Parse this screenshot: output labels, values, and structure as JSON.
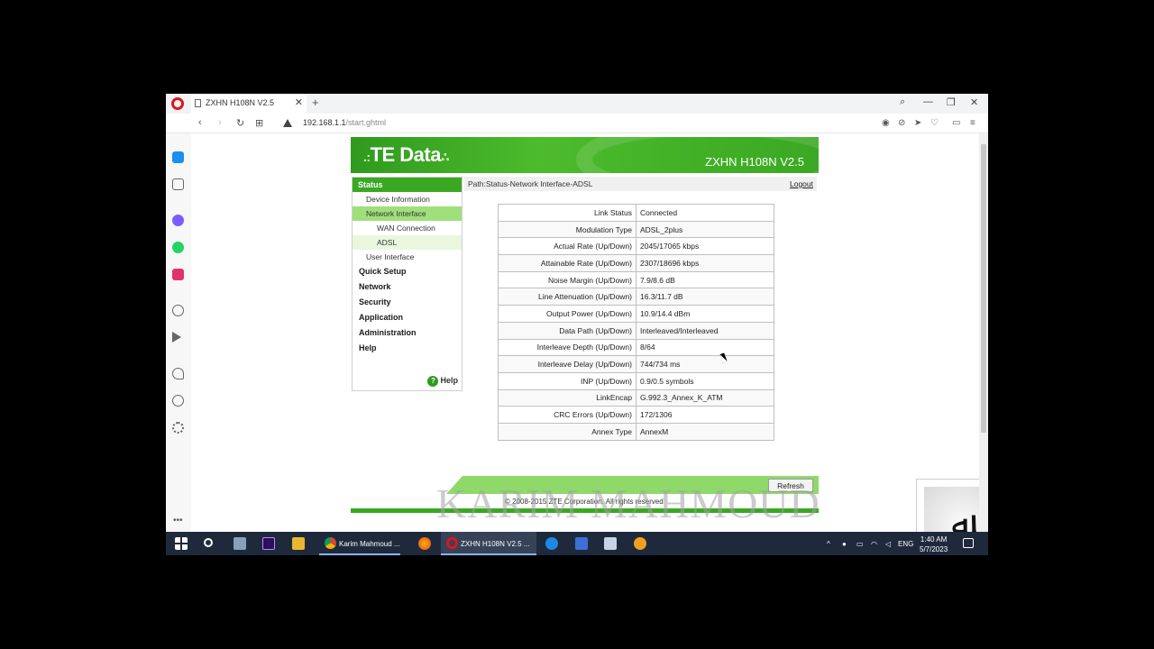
{
  "browser": {
    "tab_title": "ZXHN H108N V2.5",
    "url_host": "192.168.1.1",
    "url_path": "/start.ghtml"
  },
  "router": {
    "logo": "TE Data",
    "model": "ZXHN H108N V2.5",
    "path": "Path:Status-Network Interface-ADSL",
    "logout": "Logout",
    "menu": {
      "status": "Status",
      "device_information": "Device Information",
      "network_interface": "Network Interface",
      "wan_connection": "WAN Connection",
      "adsl": "ADSL",
      "user_interface": "User Interface",
      "quick_setup": "Quick Setup",
      "network": "Network",
      "security": "Security",
      "application": "Application",
      "administration": "Administration",
      "help": "Help"
    },
    "help_button": "Help",
    "rows": [
      {
        "key": "Link Status",
        "value": "Connected"
      },
      {
        "key": "Modulation Type",
        "value": "ADSL_2plus"
      },
      {
        "key": "Actual Rate (Up/Down)",
        "value": "2045/17065 kbps"
      },
      {
        "key": "Attainable Rate (Up/Down)",
        "value": "2307/18696 kbps"
      },
      {
        "key": "Noise Margin (Up/Down)",
        "value": "7.9/8.6 dB"
      },
      {
        "key": "Line Attenuation (Up/Down)",
        "value": "16.3/11.7 dB"
      },
      {
        "key": "Output Power (Up/Down)",
        "value": "10.9/14.4 dBm"
      },
      {
        "key": "Data Path (Up/Down)",
        "value": "Interleaved/Interleaved"
      },
      {
        "key": "Interleave Depth (Up/Down)",
        "value": "8/64"
      },
      {
        "key": "Interleave Delay (Up/Down)",
        "value": "744/734 ms"
      },
      {
        "key": "INP (Up/Down)",
        "value": "0.9/0.5 symbols"
      },
      {
        "key": "LinkEncap",
        "value": "G.992.3_Annex_K_ATM"
      },
      {
        "key": "CRC Errors (Up/Down)",
        "value": "172/1306"
      },
      {
        "key": "Annex Type",
        "value": "AnnexM"
      }
    ],
    "refresh_button": "Refresh",
    "copyright": "© 2008-2015 ZTE Corporation. All rights reserved"
  },
  "watermark": "KARIM MAHMOUD",
  "taskbar": {
    "chrome_item": "Karim Mahmoud ...",
    "opera_item": "ZXHN H108N V2.5 ...",
    "lang": "ENG",
    "time": "1:40 AM",
    "date": "5/7/2023"
  }
}
